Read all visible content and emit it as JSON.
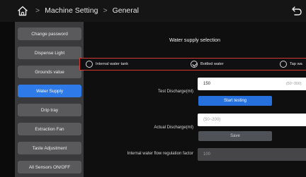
{
  "header": {
    "breadcrumb": [
      "Machine Setting",
      "General"
    ]
  },
  "sidebar": {
    "items": [
      {
        "label": "Change password",
        "active": false
      },
      {
        "label": "Dispense Light",
        "active": false
      },
      {
        "label": "Grounds value",
        "active": false
      },
      {
        "label": "Water Supply",
        "active": true
      },
      {
        "label": "Drip tray",
        "active": false
      },
      {
        "label": "Extraction Fan",
        "active": false
      },
      {
        "label": "Taste Adjustment",
        "active": false
      },
      {
        "label": "All Sensors ON/OFF",
        "active": false
      }
    ]
  },
  "main": {
    "title": "Water supply selection",
    "options": [
      {
        "label": "Internal water tank",
        "checked": false
      },
      {
        "label": "Bottled water",
        "checked": true
      },
      {
        "label": "Tap wa",
        "checked": false
      }
    ],
    "test_discharge": {
      "label": "Test Discharge(ml)",
      "value": "150",
      "range_hint": "(50~300)",
      "button": "Start testing"
    },
    "actual_discharge": {
      "label": "Actual Discharge(ml)",
      "placeholder": "(50~200)",
      "button": "Save"
    },
    "flow_factor": {
      "label": "Internal water flow regulation factor",
      "value": "100"
    }
  },
  "colors": {
    "accent": "#2d7ae8",
    "highlight_border": "#d43a2e",
    "sidebar_bg": "#3a3a3c",
    "item_bg": "#5a5a5d"
  }
}
